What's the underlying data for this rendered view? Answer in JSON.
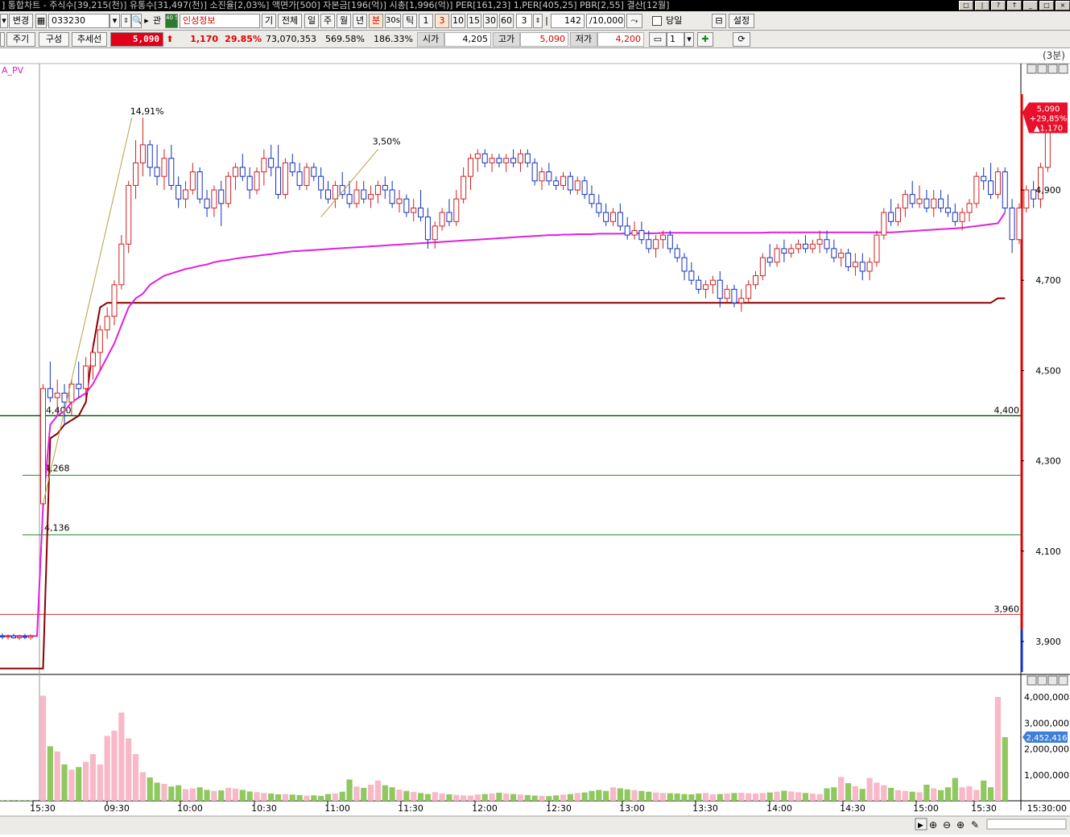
{
  "titlebar": {
    "text": "] 통합차트 - 주식수[39,215(천)] 유통수[31,497(천)] 소진율[2,03%] 액면가[500] 자본금[196(억)] 시총[1,996(억)] PER[161,23] 1,PER[405,25] PBR[2,55] 결산[12월]"
  },
  "toolbar1": {
    "change_label": "변경",
    "code_value": "033230",
    "interest_label": "관",
    "badge_label": "40 50",
    "stock_name": "인성정보",
    "gi_label": "기",
    "all_label": "전체",
    "periods": [
      "일",
      "주",
      "월",
      "년",
      "분",
      "30s",
      "틱"
    ],
    "minute_options": [
      "1",
      "3",
      "10",
      "15",
      "30",
      "60"
    ],
    "minute_value": "3",
    "count_value": "142",
    "max_value": "/10,000",
    "today_label": "당일",
    "settings_label": "설정"
  },
  "toolbar2": {
    "cycle_label": "주기",
    "compose_label": "구성",
    "trend_label": "추세선",
    "price": "5,090",
    "change": "1,170",
    "change_pct": "29.85%",
    "volume": "73,070,353",
    "vol_ratio": "569.58%",
    "turnover": "186.33%",
    "open_label": "시가",
    "open_value": "4,205",
    "high_label": "고가",
    "high_value": "5,090",
    "low_label": "저가",
    "low_value": "4,200",
    "screen_count": "1"
  },
  "chart_data": {
    "type": "candlestick",
    "timeframe_label": "(3분)",
    "indicator_label": "A_PV",
    "ylim": [
      3830,
      5170
    ],
    "y_ticks": [
      "4,900",
      "4,700",
      "4,500",
      "4,300",
      "4,100",
      "3,900"
    ],
    "price_badge": {
      "price": "5,090",
      "pct": "+29,85%",
      "change": "▲1,170"
    },
    "x_ticks": [
      "15:30",
      "09:30",
      "10:00",
      "10:30",
      "11:00",
      "11:30",
      "12:00",
      "12:30",
      "13:00",
      "13:30",
      "14:00",
      "14:30",
      "15:00",
      "15:30"
    ],
    "x_end_label": "15:30:00",
    "levels": [
      {
        "value": 4400,
        "label": "4,400",
        "color": "#006400"
      },
      {
        "value": 4268,
        "label": "4,268",
        "color": "#2e8b2e"
      },
      {
        "value": 4136,
        "label": "4,136",
        "color": "#2e8b2e"
      },
      {
        "value": 3960,
        "label": "3,960",
        "color": "#d03030"
      }
    ],
    "annotations": [
      "14,91%",
      "3,50%"
    ],
    "volume_ticks": [
      "4,000,000",
      "3,000,000",
      "2,000,000",
      "1,000,000"
    ],
    "volume_badge": "2,452,416",
    "prev_candles": [
      [
        3912,
        3918,
        3905,
        3910
      ],
      [
        3910,
        3916,
        3904,
        3912
      ],
      [
        3912,
        3917,
        3906,
        3908
      ],
      [
        3908,
        3915,
        3903,
        3911
      ],
      [
        3911,
        3917,
        3905,
        3909
      ],
      [
        3909,
        3916,
        3904,
        3912
      ]
    ],
    "prev_volumes": [
      20000,
      15000,
      25000,
      18000,
      22000,
      20000
    ],
    "candles": [
      [
        4205,
        4470,
        4200,
        4460
      ],
      [
        4460,
        4520,
        4430,
        4440
      ],
      [
        4440,
        4480,
        4400,
        4450
      ],
      [
        4450,
        4470,
        4380,
        4430
      ],
      [
        4430,
        4480,
        4400,
        4470
      ],
      [
        4470,
        4520,
        4440,
        4460
      ],
      [
        4460,
        4530,
        4440,
        4510
      ],
      [
        4510,
        4560,
        4480,
        4540
      ],
      [
        4540,
        4600,
        4500,
        4590
      ],
      [
        4590,
        4640,
        4570,
        4620
      ],
      [
        4620,
        4700,
        4600,
        4690
      ],
      [
        4690,
        4800,
        4680,
        4780
      ],
      [
        4780,
        4920,
        4760,
        4910
      ],
      [
        4910,
        5010,
        4880,
        4960
      ],
      [
        4960,
        5060,
        4930,
        5000
      ],
      [
        5000,
        5010,
        4930,
        4950
      ],
      [
        4950,
        5000,
        4910,
        4930
      ],
      [
        4930,
        4990,
        4900,
        4970
      ],
      [
        4970,
        5000,
        4900,
        4910
      ],
      [
        4910,
        4930,
        4860,
        4880
      ],
      [
        4880,
        4920,
        4860,
        4900
      ],
      [
        4900,
        4960,
        4890,
        4940
      ],
      [
        4940,
        4950,
        4870,
        4880
      ],
      [
        4880,
        4900,
        4840,
        4860
      ],
      [
        4860,
        4910,
        4840,
        4900
      ],
      [
        4900,
        4920,
        4820,
        4870
      ],
      [
        4870,
        4940,
        4860,
        4930
      ],
      [
        4930,
        4960,
        4900,
        4950
      ],
      [
        4950,
        4980,
        4920,
        4930
      ],
      [
        4930,
        4950,
        4880,
        4900
      ],
      [
        4900,
        4950,
        4890,
        4940
      ],
      [
        4940,
        4990,
        4910,
        4970
      ],
      [
        4970,
        5000,
        4930,
        4950
      ],
      [
        4950,
        5000,
        4880,
        4890
      ],
      [
        4890,
        4970,
        4880,
        4960
      ],
      [
        4960,
        4980,
        4930,
        4940
      ],
      [
        4940,
        4960,
        4900,
        4910
      ],
      [
        4910,
        4960,
        4900,
        4950
      ],
      [
        4950,
        4960,
        4920,
        4930
      ],
      [
        4930,
        4950,
        4880,
        4900
      ],
      [
        4900,
        4920,
        4870,
        4880
      ],
      [
        4880,
        4920,
        4860,
        4910
      ],
      [
        4910,
        4940,
        4880,
        4890
      ],
      [
        4890,
        4920,
        4860,
        4870
      ],
      [
        4870,
        4920,
        4860,
        4900
      ],
      [
        4900,
        4920,
        4870,
        4880
      ],
      [
        4880,
        4910,
        4860,
        4890
      ],
      [
        4890,
        4920,
        4870,
        4910
      ],
      [
        4910,
        4930,
        4880,
        4900
      ],
      [
        4900,
        4920,
        4860,
        4870
      ],
      [
        4870,
        4900,
        4850,
        4880
      ],
      [
        4880,
        4890,
        4840,
        4850
      ],
      [
        4850,
        4880,
        4830,
        4860
      ],
      [
        4860,
        4900,
        4830,
        4840
      ],
      [
        4840,
        4860,
        4770,
        4790
      ],
      [
        4790,
        4830,
        4770,
        4820
      ],
      [
        4820,
        4860,
        4810,
        4850
      ],
      [
        4850,
        4880,
        4820,
        4830
      ],
      [
        4830,
        4900,
        4820,
        4880
      ],
      [
        4880,
        4950,
        4870,
        4930
      ],
      [
        4930,
        4980,
        4900,
        4970
      ],
      [
        4970,
        4990,
        4940,
        4980
      ],
      [
        4980,
        4990,
        4950,
        4960
      ],
      [
        4960,
        4980,
        4940,
        4970
      ],
      [
        4970,
        4980,
        4950,
        4960
      ],
      [
        4960,
        4980,
        4940,
        4970
      ],
      [
        4970,
        4990,
        4950,
        4960
      ],
      [
        4960,
        4990,
        4940,
        4980
      ],
      [
        4980,
        4990,
        4950,
        4960
      ],
      [
        4960,
        4970,
        4910,
        4920
      ],
      [
        4920,
        4950,
        4900,
        4940
      ],
      [
        4940,
        4960,
        4910,
        4920
      ],
      [
        4920,
        4930,
        4900,
        4910
      ],
      [
        4910,
        4940,
        4900,
        4930
      ],
      [
        4930,
        4940,
        4890,
        4900
      ],
      [
        4900,
        4930,
        4890,
        4920
      ],
      [
        4920,
        4930,
        4880,
        4890
      ],
      [
        4890,
        4910,
        4860,
        4870
      ],
      [
        4870,
        4890,
        4840,
        4850
      ],
      [
        4850,
        4870,
        4820,
        4830
      ],
      [
        4830,
        4860,
        4820,
        4850
      ],
      [
        4850,
        4870,
        4810,
        4820
      ],
      [
        4820,
        4840,
        4790,
        4800
      ],
      [
        4800,
        4830,
        4790,
        4810
      ],
      [
        4810,
        4830,
        4780,
        4790
      ],
      [
        4790,
        4810,
        4760,
        4770
      ],
      [
        4770,
        4800,
        4750,
        4790
      ],
      [
        4790,
        4810,
        4770,
        4800
      ],
      [
        4800,
        4810,
        4760,
        4770
      ],
      [
        4770,
        4780,
        4740,
        4750
      ],
      [
        4750,
        4760,
        4700,
        4720
      ],
      [
        4720,
        4740,
        4690,
        4700
      ],
      [
        4700,
        4710,
        4670,
        4680
      ],
      [
        4680,
        4700,
        4660,
        4690
      ],
      [
        4690,
        4710,
        4670,
        4700
      ],
      [
        4700,
        4720,
        4640,
        4660
      ],
      [
        4660,
        4690,
        4650,
        4680
      ],
      [
        4680,
        4690,
        4640,
        4650
      ],
      [
        4650,
        4680,
        4630,
        4660
      ],
      [
        4660,
        4700,
        4650,
        4690
      ],
      [
        4690,
        4720,
        4680,
        4710
      ],
      [
        4710,
        4760,
        4700,
        4750
      ],
      [
        4750,
        4780,
        4730,
        4740
      ],
      [
        4740,
        4780,
        4730,
        4770
      ],
      [
        4770,
        4790,
        4740,
        4760
      ],
      [
        4760,
        4780,
        4750,
        4770
      ],
      [
        4770,
        4790,
        4760,
        4780
      ],
      [
        4780,
        4800,
        4760,
        4770
      ],
      [
        4770,
        4790,
        4760,
        4780
      ],
      [
        4780,
        4810,
        4760,
        4790
      ],
      [
        4790,
        4810,
        4760,
        4770
      ],
      [
        4770,
        4790,
        4740,
        4750
      ],
      [
        4750,
        4770,
        4730,
        4760
      ],
      [
        4760,
        4770,
        4720,
        4730
      ],
      [
        4730,
        4760,
        4710,
        4740
      ],
      [
        4740,
        4760,
        4700,
        4720
      ],
      [
        4720,
        4750,
        4700,
        4740
      ],
      [
        4740,
        4810,
        4730,
        4800
      ],
      [
        4800,
        4860,
        4790,
        4850
      ],
      [
        4850,
        4880,
        4820,
        4830
      ],
      [
        4830,
        4870,
        4820,
        4860
      ],
      [
        4860,
        4900,
        4840,
        4890
      ],
      [
        4890,
        4920,
        4860,
        4870
      ],
      [
        4870,
        4910,
        4860,
        4880
      ],
      [
        4880,
        4900,
        4850,
        4860
      ],
      [
        4860,
        4900,
        4840,
        4880
      ],
      [
        4880,
        4900,
        4850,
        4860
      ],
      [
        4860,
        4890,
        4840,
        4850
      ],
      [
        4850,
        4870,
        4820,
        4830
      ],
      [
        4830,
        4860,
        4810,
        4850
      ],
      [
        4850,
        4880,
        4830,
        4870
      ],
      [
        4870,
        4940,
        4860,
        4930
      ],
      [
        4930,
        4950,
        4900,
        4920
      ],
      [
        4920,
        4960,
        4880,
        4890
      ],
      [
        4890,
        4950,
        4880,
        4940
      ],
      [
        4940,
        4950,
        4850,
        4860
      ],
      [
        4860,
        4880,
        4760,
        4790
      ],
      [
        4790,
        4870,
        4780,
        4860
      ],
      [
        4860,
        4910,
        4850,
        4900
      ],
      [
        4900,
        4920,
        4860,
        4880
      ],
      [
        4880,
        4960,
        4860,
        4950
      ],
      [
        4950,
        5090,
        4940,
        5090
      ]
    ],
    "volumes": [
      4050000,
      2100000,
      1900000,
      1400000,
      1200000,
      1300000,
      1500000,
      1800000,
      1400000,
      2500000,
      2700000,
      3400000,
      2400000,
      1800000,
      1100000,
      900000,
      700000,
      650000,
      550000,
      600000,
      450000,
      480000,
      520000,
      420000,
      380000,
      400000,
      500000,
      470000,
      420000,
      360000,
      330000,
      300000,
      280000,
      250000,
      260000,
      240000,
      220000,
      200000,
      210000,
      190000,
      260000,
      280000,
      350000,
      820000,
      550000,
      500000,
      620000,
      780000,
      600000,
      520000,
      430000,
      380000,
      340000,
      300000,
      260000,
      330000,
      280000,
      250000,
      230000,
      210000,
      200000,
      240000,
      260000,
      280000,
      310000,
      280000,
      260000,
      240000,
      220000,
      200000,
      190000,
      180000,
      210000,
      240000,
      260000,
      300000,
      320000,
      380000,
      420000,
      380000,
      520000,
      480000,
      440000,
      410000,
      380000,
      350000,
      320000,
      300000,
      290000,
      280000,
      260000,
      250000,
      280000,
      300000,
      250000,
      260000,
      280000,
      300000,
      310000,
      290000,
      280000,
      300000,
      320000,
      350000,
      390000,
      360000,
      330000,
      300000,
      280000,
      260000,
      480000,
      520000,
      920000,
      680000,
      560000,
      460000,
      880000,
      700000,
      600000,
      500000,
      410000,
      380000,
      350000,
      330000,
      620000,
      480000,
      410000,
      520000,
      880000,
      520000,
      560000,
      420000,
      780000,
      520000,
      4000000,
      2450000
    ],
    "vwap": [
      4200,
      4380,
      4400,
      4410,
      4430,
      4440,
      4450,
      4470,
      4500,
      4530,
      4560,
      4600,
      4640,
      4660,
      4670,
      4690,
      4700,
      4710,
      4715,
      4720,
      4725,
      4728,
      4732,
      4735,
      4740,
      4743,
      4745,
      4748,
      4750,
      4752,
      4754,
      4756,
      4758,
      4760,
      4762,
      4764,
      4765,
      4766,
      4767,
      4768,
      4769,
      4770,
      4771,
      4772,
      4773,
      4774,
      4775,
      4776,
      4777,
      4778,
      4779,
      4780,
      4781,
      4782,
      4783,
      4784,
      4785,
      4786,
      4787,
      4788,
      4789,
      4790,
      4791,
      4792,
      4793,
      4794,
      4795,
      4796,
      4797,
      4798,
      4799,
      4800,
      4800,
      4801,
      4801,
      4802,
      4802,
      4802,
      4803,
      4803,
      4803,
      4803,
      4804,
      4804,
      4804,
      4804,
      4804,
      4805,
      4805,
      4805,
      4805,
      4805,
      4805,
      4805,
      4805,
      4805,
      4805,
      4805,
      4805,
      4805,
      4805,
      4805,
      4806,
      4806,
      4806,
      4806,
      4806,
      4806,
      4806,
      4806,
      4806,
      4806,
      4806,
      4806,
      4806,
      4806,
      4806,
      4806,
      4806,
      4806,
      4807,
      4808,
      4809,
      4810,
      4811,
      4812,
      4813,
      4814,
      4815,
      4816,
      4818,
      4820,
      4822,
      4824,
      4826,
      4850
    ],
    "support_line": [
      3840,
      4350,
      4360,
      4380,
      4390,
      4400,
      4430,
      4550,
      4640,
      4650,
      4650,
      4650,
      4650,
      4650,
      4650,
      4650,
      4650,
      4650,
      4650,
      4650,
      4650,
      4650,
      4650,
      4650,
      4650,
      4650,
      4650,
      4650,
      4650,
      4650,
      4650,
      4650,
      4650,
      4650,
      4650,
      4650,
      4650,
      4650,
      4650,
      4650,
      4650,
      4650,
      4650,
      4650,
      4650,
      4650,
      4650,
      4650,
      4650,
      4650,
      4650,
      4650,
      4650,
      4650,
      4650,
      4650,
      4650,
      4650,
      4650,
      4650,
      4650,
      4650,
      4650,
      4650,
      4650,
      4650,
      4650,
      4650,
      4650,
      4650,
      4650,
      4650,
      4650,
      4650,
      4650,
      4650,
      4650,
      4650,
      4650,
      4650,
      4650,
      4650,
      4650,
      4650,
      4650,
      4650,
      4650,
      4650,
      4650,
      4650,
      4650,
      4650,
      4650,
      4650,
      4650,
      4650,
      4650,
      4650,
      4650,
      4650,
      4650,
      4650,
      4650,
      4650,
      4650,
      4650,
      4650,
      4650,
      4650,
      4650,
      4650,
      4650,
      4650,
      4650,
      4650,
      4650,
      4650,
      4650,
      4650,
      4650,
      4650,
      4650,
      4650,
      4650,
      4650,
      4650,
      4650,
      4650,
      4650,
      4650,
      4650,
      4650,
      4650,
      4650,
      4660,
      4660
    ],
    "colors": {
      "up": "#d02020",
      "down": "#1030c0",
      "vol_up": "#f8b8c8",
      "vol_down": "#90c860",
      "vwap": "#e020e0",
      "support": "#8b0000",
      "axis_red": "#e00000"
    }
  }
}
